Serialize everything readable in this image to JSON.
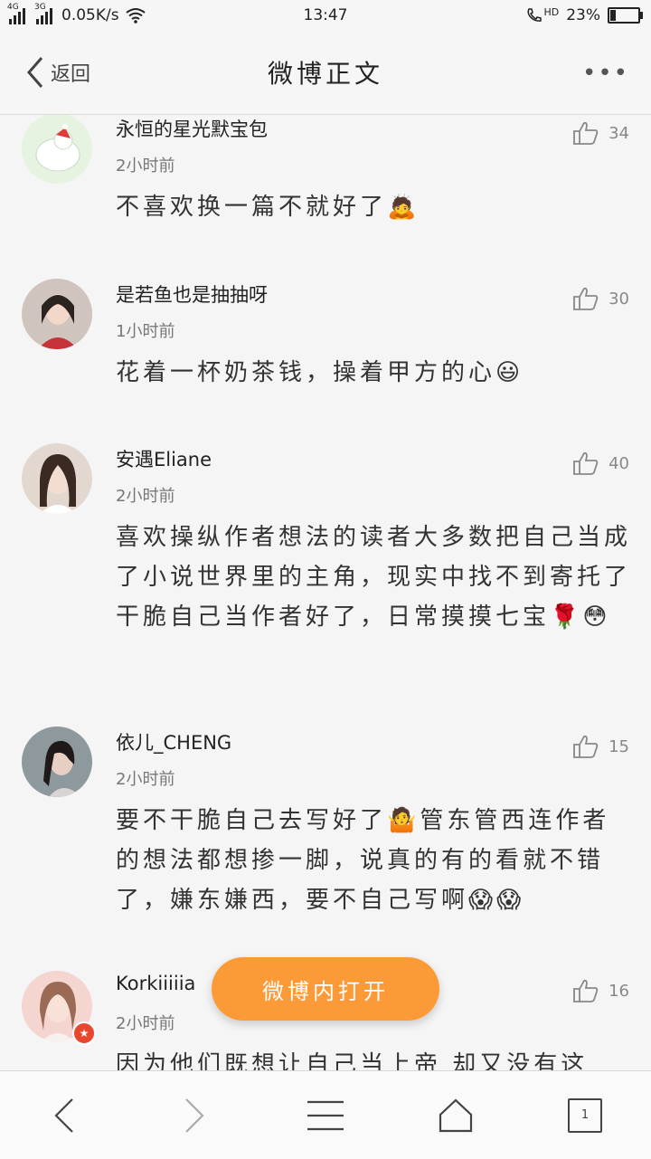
{
  "status_bar": {
    "network1": "4G",
    "network2": "3G",
    "speed": "0.05K/s",
    "time": "13:47",
    "hd_label": "HD",
    "battery": "23%",
    "battery_level": 0.23
  },
  "nav": {
    "back_label": "返回",
    "title": "微博正文"
  },
  "comments": [
    {
      "name": "永恒的星光默宝包",
      "time": "2小时前",
      "text": "不喜欢换一篇不就好了🙇",
      "likes": "34",
      "avatar_color": "#e6f3e1"
    },
    {
      "name": "是若鱼也是抽抽呀",
      "time": "1小时前",
      "text": "花着一杯奶茶钱，操着甲方的心😃",
      "likes": "30",
      "avatar_color": "#c9b8b2"
    },
    {
      "name": "安遇Eliane",
      "time": "2小时前",
      "text": "喜欢操纵作者想法的读者大多数把自己当成了小说世界里的主角，现实中找不到寄托了干脆自己当作者好了，日常摸摸七宝🌹😳",
      "likes": "40",
      "avatar_color": "#d9c9bf"
    },
    {
      "name": "依儿_CHENG",
      "time": "2小时前",
      "text": "要不干脆自己去写好了🤷管东管西连作者的想法都想掺一脚，说真的有的看就不错了，嫌东嫌西，要不自己写啊😱😱",
      "likes": "15",
      "avatar_color": "#9aa3a8"
    },
    {
      "name": "Korkiiiiia",
      "time": "2小时前",
      "text": "因为他们既想让自己当上帝 却又没有这",
      "likes": "16",
      "avatar_color": "#f2c7c2"
    }
  ],
  "open_button": "微博内打开",
  "toolbar": {
    "tab_count": "1"
  },
  "colors": {
    "accent": "#fd9a38",
    "vip": "#e8462e"
  }
}
